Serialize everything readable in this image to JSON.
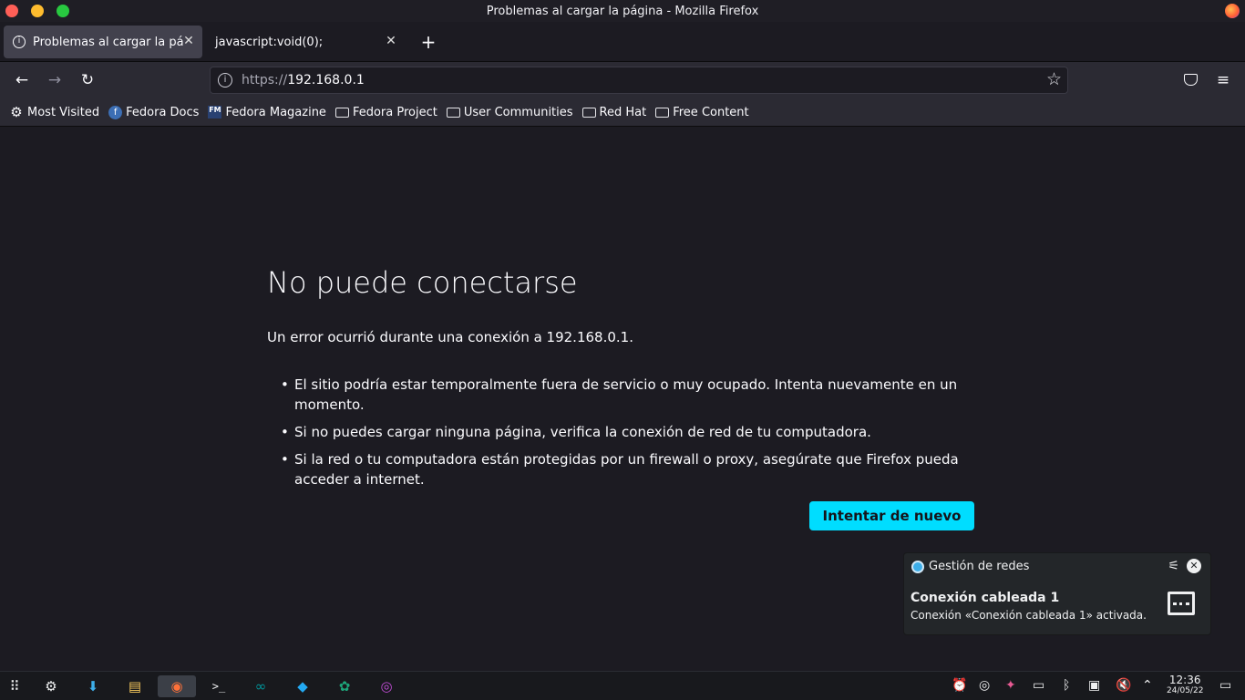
{
  "window": {
    "title": "Problemas al cargar la página - Mozilla Firefox"
  },
  "tabs": [
    {
      "label": "Problemas al cargar la págin",
      "active": true
    },
    {
      "label": "javascript:void(0);",
      "active": false
    }
  ],
  "urlbar": {
    "protocol": "https://",
    "host": "192.168.0.1"
  },
  "bookmarks": [
    {
      "label": "Most Visited",
      "icon": "gear-icon"
    },
    {
      "label": "Fedora Docs",
      "icon": "fedora-icon"
    },
    {
      "label": "Fedora Magazine",
      "icon": "fm-icon"
    },
    {
      "label": "Fedora Project",
      "icon": "folder-icon"
    },
    {
      "label": "User Communities",
      "icon": "folder-icon"
    },
    {
      "label": "Red Hat",
      "icon": "folder-icon"
    },
    {
      "label": "Free Content",
      "icon": "folder-icon"
    }
  ],
  "error": {
    "title": "No puede conectarse",
    "description": "Un error ocurrió durante una conexión a 192.168.0.1.",
    "items": [
      "El sitio podría estar temporalmente fuera de servicio o muy ocupado. Intenta nuevamente en un momento.",
      "Si no puedes cargar ninguna página, verifica la conexión de red de tu computadora.",
      "Si la red o tu computadora están protegidas por un firewall o proxy, asegúrate que Firefox pueda acceder a internet."
    ],
    "retry_label": "Intentar de nuevo"
  },
  "notification": {
    "app": "Gestión de redes",
    "heading": "Conexión cableada 1",
    "body": "Conexión «Conexión cableada 1» activada."
  },
  "clock": {
    "time": "12:36",
    "date": "24/05/22"
  },
  "colors": {
    "accent": "#00ddff",
    "background": "#1c1b22",
    "toolbar": "#2b2a33"
  }
}
